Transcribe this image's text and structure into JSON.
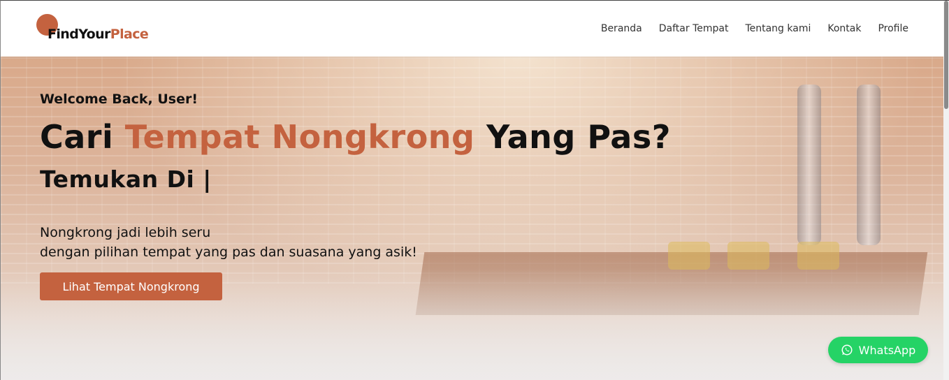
{
  "brand": {
    "name_part1": "FindYour",
    "name_part2": "Place",
    "accent_color": "#c4623f"
  },
  "nav": {
    "items": [
      {
        "label": "Beranda"
      },
      {
        "label": "Daftar Tempat"
      },
      {
        "label": "Tentang kami"
      },
      {
        "label": "Kontak"
      },
      {
        "label": "Profile"
      }
    ]
  },
  "hero": {
    "welcome": "Welcome Back, User!",
    "headline_part1": "Cari ",
    "headline_accent": "Tempat Nongkrong",
    "headline_part2": " Yang Pas?",
    "sub_headline": "Temukan Di |",
    "description_line1": "Nongkrong jadi lebih seru",
    "description_line2": "dengan pilihan tempat yang pas dan suasana yang asik!",
    "cta_label": "Lihat Tempat Nongkrong"
  },
  "whatsapp": {
    "label": "WhatsApp",
    "icon": "whatsapp-icon",
    "color": "#25d366"
  }
}
